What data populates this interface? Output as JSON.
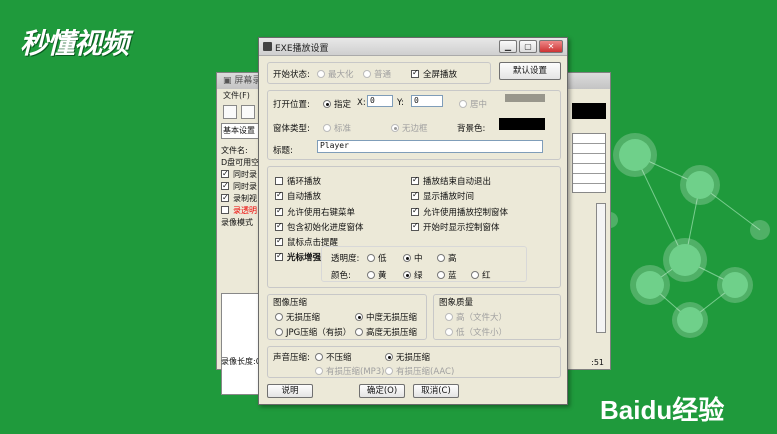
{
  "background": {
    "logo_top_left": "秒懂视频",
    "logo_bottom_right": "Baidu经验",
    "color": "#1f9a3c"
  },
  "back_window": {
    "title": "屏幕录像",
    "menu_item": "文件(F)",
    "tab": "基本设置",
    "file_label": "文件名:",
    "disk_label": "D盘可用空",
    "checks": [
      "同时录",
      "同时录",
      "录制视",
      "录透明"
    ],
    "mode_label": "录像模式",
    "status_left": "录像长度:00",
    "status_right": ":51"
  },
  "dialog": {
    "title": "EXE播放设置",
    "window_buttons": [
      "minimize-icon",
      "maximize-icon",
      "close-icon"
    ],
    "start_state": {
      "label": "开始状态:",
      "opt_max": "最大化",
      "opt_normal": "普通",
      "fullscreen": "全屏播放",
      "default_button": "默认设置"
    },
    "open_position": {
      "label": "打开位置:",
      "opt_specify": "指定",
      "x_label": "X:",
      "x_value": "0",
      "y_label": "Y:",
      "y_value": "0",
      "opt_center": "居中",
      "window_type_label": "窗体类型:",
      "opt_standard": "标准",
      "opt_borderless": "无边框",
      "bg_color_label": "背景色:",
      "title_label": "标题:",
      "title_value": "Player"
    },
    "options_left": [
      {
        "label": "循环播放",
        "checked": false
      },
      {
        "label": "自动播放",
        "checked": true
      },
      {
        "label": "允许使用右键菜单",
        "checked": true
      },
      {
        "label": "包含初始化进度窗体",
        "checked": true
      },
      {
        "label": "鼠标点击提醒",
        "checked": true
      },
      {
        "label": "光标增强",
        "checked": true
      }
    ],
    "options_right": [
      {
        "label": "播放结束自动退出",
        "checked": true
      },
      {
        "label": "显示播放时间",
        "checked": true
      },
      {
        "label": "允许使用播放控制窗体",
        "checked": true
      },
      {
        "label": "开始时显示控制窗体",
        "checked": true
      }
    ],
    "cursor": {
      "transparency_label": "透明度:",
      "t_low": "低",
      "t_mid": "中",
      "t_high": "高",
      "color_label": "颜色:",
      "c_yellow": "黄",
      "c_green": "绿",
      "c_blue": "蓝",
      "c_red": "红"
    },
    "image_compress": {
      "title": "图像压缩",
      "lossless": "无损压缩",
      "medium": "中度无损压缩",
      "jpg": "JPG压缩（有损）",
      "high": "高度无损压缩"
    },
    "image_quality": {
      "title": "图象质量",
      "high": "高（文件大）",
      "low": "低（文件小）"
    },
    "audio": {
      "label": "声音压缩:",
      "none": "不压缩",
      "lossless": "无损压缩",
      "mp3": "有损压缩(MP3)",
      "aac": "有损压缩(AAC)"
    },
    "buttons": {
      "help": "说明",
      "ok": "确定(O)",
      "cancel": "取消(C)"
    }
  }
}
